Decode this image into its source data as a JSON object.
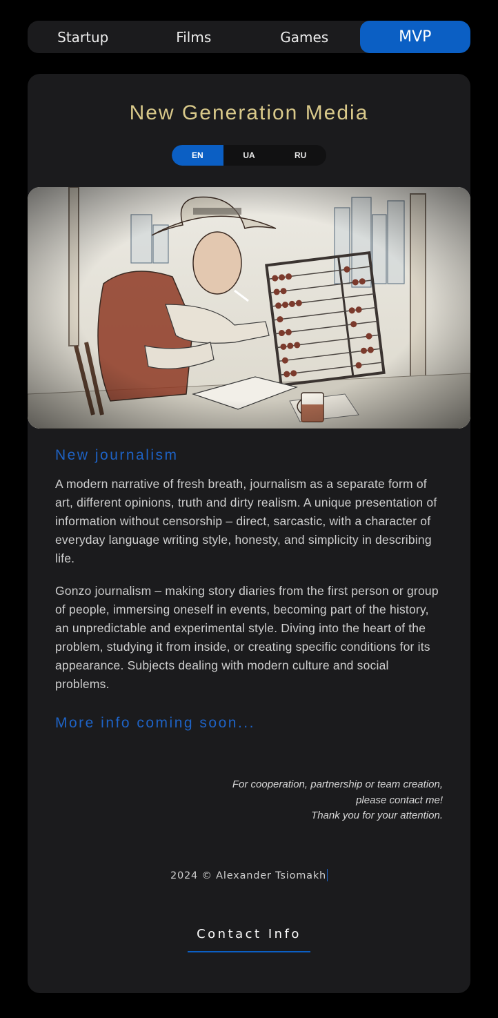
{
  "nav": {
    "tabs": [
      {
        "label": "Startup"
      },
      {
        "label": "Films"
      },
      {
        "label": "Games"
      },
      {
        "label": "MVP"
      }
    ],
    "active_index": 3
  },
  "card": {
    "title": "New Generation Media",
    "languages": [
      "EN",
      "UA",
      "RU"
    ],
    "active_language": "EN",
    "sections": [
      {
        "heading": "New journalism",
        "paragraphs": [
          "A modern narrative of fresh breath, journalism as a separate form of art, different opinions, truth and dirty realism. A unique presentation of information without censorship – direct, sarcastic, with a character of everyday language writing style, honesty, and simplicity in describing life.",
          "Gonzo journalism – making story diaries from the first person or group of people, immersing oneself in events, becoming part of the history, an unpredictable and experimental style. Diving into the heart of the problem, studying it from inside, or creating specific conditions for its appearance. Subjects dealing with modern culture and social problems."
        ]
      }
    ],
    "more_info": "More info coming soon...",
    "note_lines": [
      "For cooperation, partnership or team creation,",
      "please contact me!",
      "Thank you for your attention."
    ],
    "footer": "2024 © Alexander Tsiomakh",
    "contact_label": "Contact Info"
  },
  "colors": {
    "background": "#000000",
    "card": "#1b1b1d",
    "accent": "#0b5fc4",
    "title_gold": "#d9c98a",
    "heading_blue": "#1e63c6"
  }
}
